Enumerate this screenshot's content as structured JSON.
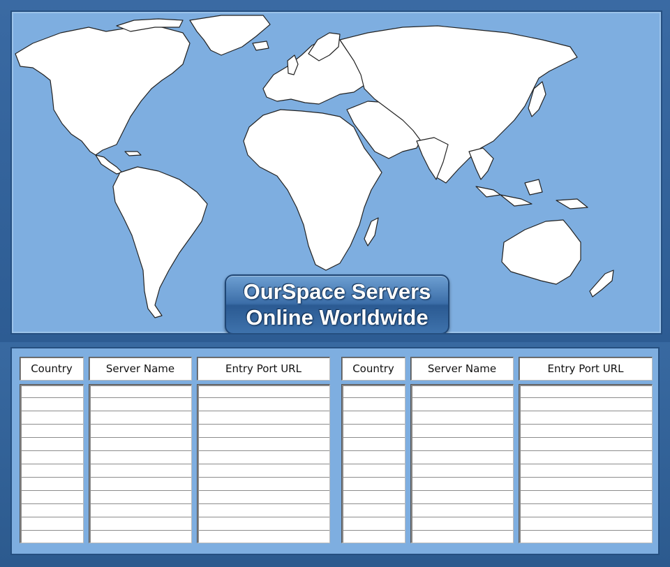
{
  "map": {
    "title_line1": "OurSpace Servers",
    "title_line2": "Online Worldwide",
    "ocean_color": "#7eaee0",
    "land_color": "#ffffff"
  },
  "tables": [
    {
      "headers": {
        "country": "Country",
        "server_name": "Server Name",
        "entry_port_url": "Entry Port URL"
      },
      "rows": []
    },
    {
      "headers": {
        "country": "Country",
        "server_name": "Server Name",
        "entry_port_url": "Entry Port URL"
      },
      "rows": []
    }
  ]
}
